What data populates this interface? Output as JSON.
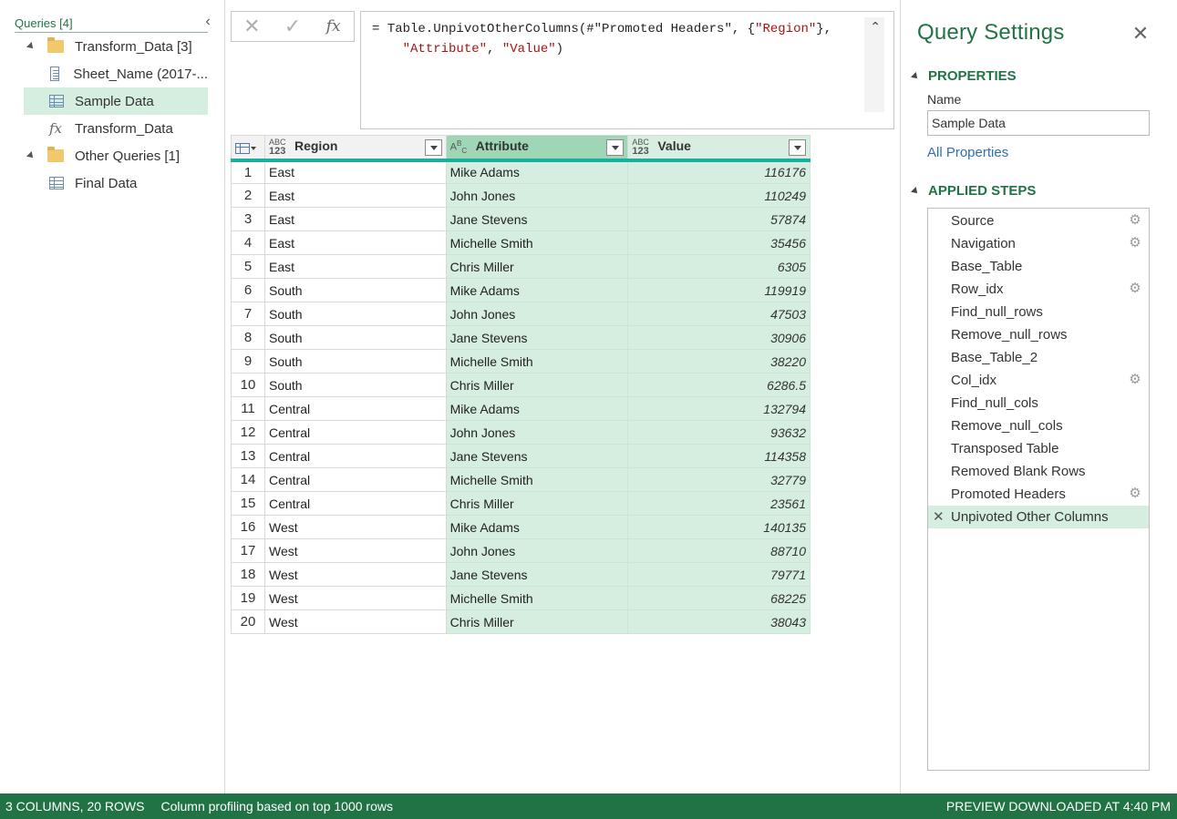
{
  "queries": {
    "title": "Queries [4]",
    "groups": [
      {
        "label": "Transform_Data [3]"
      },
      {
        "label": "Other Queries [1]"
      }
    ],
    "items": [
      {
        "label": "Sheet_Name (2017-...",
        "icon": "sheet-icon"
      },
      {
        "label": "Sample Data",
        "icon": "table-icon",
        "selected": true
      },
      {
        "label": "Transform_Data",
        "icon": "function-icon"
      },
      {
        "label": "Final Data",
        "icon": "table-icon"
      }
    ]
  },
  "formula_bar": {
    "cancel": "✕",
    "commit": "✓",
    "fx": "fx",
    "line1_prefix": "= Table.UnpivotOtherColumns(#\"Promoted Headers\", {",
    "line1_str": "\"Region\"",
    "line1_suffix": "},",
    "line2_indent": "    ",
    "line2_str1": "\"Attribute\"",
    "line2_sep": ", ",
    "line2_str2": "\"Value\"",
    "line2_suffix": ")"
  },
  "grid": {
    "columns": [
      {
        "name": "Region",
        "type": "ABC/123"
      },
      {
        "name": "Attribute",
        "type": "ABC"
      },
      {
        "name": "Value",
        "type": "ABC/123"
      }
    ],
    "rows": [
      [
        "1",
        "East",
        "Mike Adams",
        "116176"
      ],
      [
        "2",
        "East",
        "John Jones",
        "110249"
      ],
      [
        "3",
        "East",
        "Jane Stevens",
        "57874"
      ],
      [
        "4",
        "East",
        "Michelle Smith",
        "35456"
      ],
      [
        "5",
        "East",
        "Chris Miller",
        "6305"
      ],
      [
        "6",
        "South",
        "Mike Adams",
        "119919"
      ],
      [
        "7",
        "South",
        "John Jones",
        "47503"
      ],
      [
        "8",
        "South",
        "Jane Stevens",
        "30906"
      ],
      [
        "9",
        "South",
        "Michelle Smith",
        "38220"
      ],
      [
        "10",
        "South",
        "Chris Miller",
        "6286.5"
      ],
      [
        "11",
        "Central",
        "Mike Adams",
        "132794"
      ],
      [
        "12",
        "Central",
        "John Jones",
        "93632"
      ],
      [
        "13",
        "Central",
        "Jane Stevens",
        "114358"
      ],
      [
        "14",
        "Central",
        "Michelle Smith",
        "32779"
      ],
      [
        "15",
        "Central",
        "Chris Miller",
        "23561"
      ],
      [
        "16",
        "West",
        "Mike Adams",
        "140135"
      ],
      [
        "17",
        "West",
        "John Jones",
        "88710"
      ],
      [
        "18",
        "West",
        "Jane Stevens",
        "79771"
      ],
      [
        "19",
        "West",
        "Michelle Smith",
        "68225"
      ],
      [
        "20",
        "West",
        "Chris Miller",
        "38043"
      ]
    ]
  },
  "settings": {
    "title": "Query Settings",
    "properties_heading": "PROPERTIES",
    "name_label": "Name",
    "name_value": "Sample Data",
    "all_properties": "All Properties",
    "steps_heading": "APPLIED STEPS",
    "steps": [
      {
        "label": "Source",
        "gear": true
      },
      {
        "label": "Navigation",
        "gear": true
      },
      {
        "label": "Base_Table",
        "gear": false
      },
      {
        "label": "Row_idx",
        "gear": true
      },
      {
        "label": "Find_null_rows",
        "gear": false
      },
      {
        "label": "Remove_null_rows",
        "gear": false
      },
      {
        "label": "Base_Table_2",
        "gear": false
      },
      {
        "label": "Col_idx",
        "gear": true
      },
      {
        "label": "Find_null_cols",
        "gear": false
      },
      {
        "label": "Remove_null_cols",
        "gear": false
      },
      {
        "label": "Transposed Table",
        "gear": false
      },
      {
        "label": "Removed Blank Rows",
        "gear": false
      },
      {
        "label": "Promoted Headers",
        "gear": true
      },
      {
        "label": "Unpivoted Other Columns",
        "gear": false,
        "active": true
      }
    ]
  },
  "status": {
    "columns_rows": "3 COLUMNS, 20 ROWS",
    "profiling": "Column profiling based on top 1000 rows",
    "preview": "PREVIEW DOWNLOADED AT 4:40 PM"
  },
  "colors": {
    "accent": "#217346",
    "selection": "#d6eee0",
    "selected_header": "#9fd6b5",
    "header_underline": "#1aae9f",
    "link": "#2f6fb3"
  }
}
